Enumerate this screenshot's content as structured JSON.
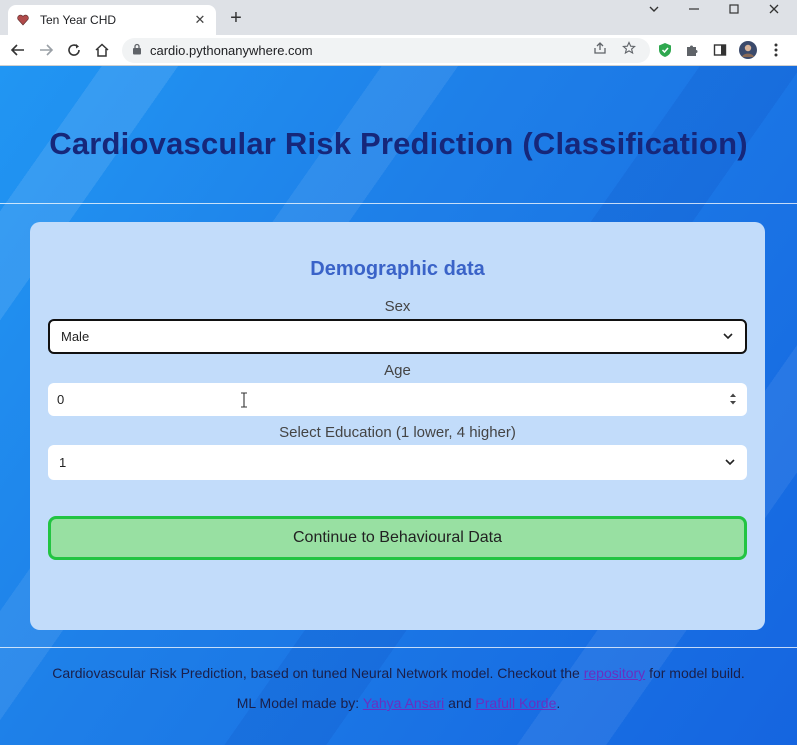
{
  "browser": {
    "tab_title": "Ten Year CHD",
    "url": "cardio.pythonanywhere.com",
    "new_tab_label": "+",
    "close_tab_label": "✕"
  },
  "header": {
    "title": "Cardiovascular Risk Prediction (Classification)"
  },
  "form": {
    "section_title": "Demographic data",
    "sex_label": "Sex",
    "sex_value": "Male",
    "age_label": "Age",
    "age_value": "0",
    "education_label": "Select Education (1 lower, 4 higher)",
    "education_value": "1",
    "continue_button": "Continue to Behavioural Data"
  },
  "footer": {
    "line1_prefix": "Cardiovascular Risk Prediction, based on tuned Neural Network model. Checkout the",
    "line1_link": "repository",
    "line1_suffix": "for model build.",
    "line2_prefix": "ML Model made by:",
    "author1": "Yahya Ansari",
    "conjunction": "and",
    "author2": "Prafull Korde",
    "line2_suffix": "."
  },
  "colors": {
    "title": "#16277a",
    "card_bg": "#c2dcfa",
    "section_title": "#3a63c8",
    "button_bg": "#98e0a2",
    "button_border": "#22c442"
  }
}
